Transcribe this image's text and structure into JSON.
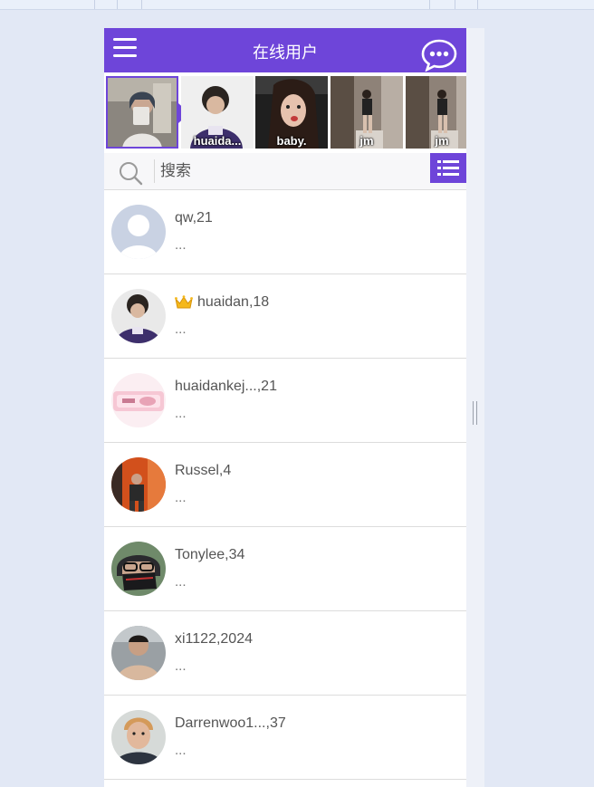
{
  "header": {
    "title": "在线用户",
    "menu_icon": "hamburger-menu-icon",
    "chat_icon": "chat-bubble-icon",
    "accent_color": "#6e45d9"
  },
  "stories": [
    {
      "label": "",
      "active": true
    },
    {
      "label": "huaida..."
    },
    {
      "label": "baby."
    },
    {
      "label": "jm"
    },
    {
      "label": "jm"
    }
  ],
  "search": {
    "placeholder": "搜索",
    "search_icon": "search-icon",
    "view_icon": "list-view-icon"
  },
  "users": [
    {
      "name": "qw,21",
      "status": "...",
      "vip": false
    },
    {
      "name": "huaidan,18",
      "status": "...",
      "vip": true
    },
    {
      "name": "huaidankej...,21",
      "status": "...",
      "vip": false
    },
    {
      "name": "Russel,4",
      "status": "...",
      "vip": false
    },
    {
      "name": "Tonylee,34",
      "status": "...",
      "vip": false
    },
    {
      "name": "xi1122,2024",
      "status": "...",
      "vip": false
    },
    {
      "name": "Darrenwoo1...,37",
      "status": "...",
      "vip": false
    }
  ]
}
